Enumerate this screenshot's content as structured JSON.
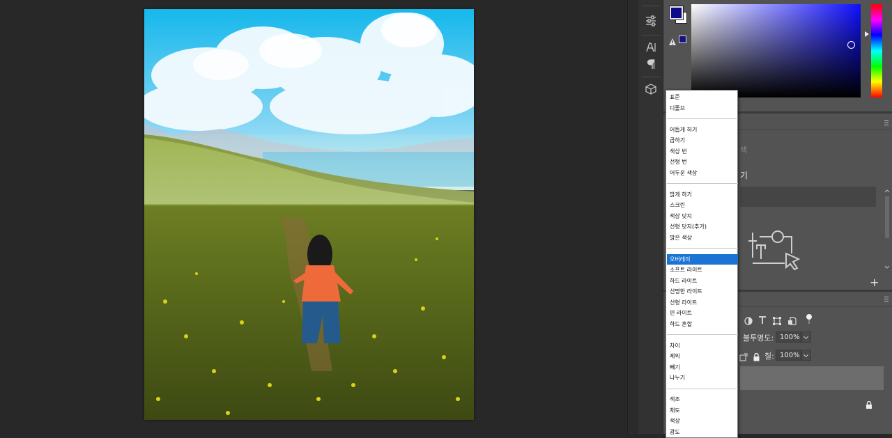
{
  "blend_menu": {
    "groups": [
      [
        "표준",
        "디졸브"
      ],
      [
        "어둡게 하기",
        "곱하기",
        "색상 번",
        "선형 번",
        "어두운 색상"
      ],
      [
        "밝게 하기",
        "스크린",
        "색상 닷지",
        "선형 닷지(추가)",
        "밝은 색상"
      ],
      [
        "오버레이",
        "소프트 라이트",
        "하드 라이트",
        "선명한 라이트",
        "선형 라이트",
        "핀 라이트",
        "하드 혼합"
      ],
      [
        "차이",
        "제외",
        "빼기",
        "나누기"
      ],
      [
        "색조",
        "채도",
        "색상",
        "광도"
      ]
    ],
    "selected": "오버레이"
  },
  "color_panel": {
    "foreground": "#0d0d8c",
    "background": "#ffffff",
    "hue": "#0000ff"
  },
  "panel": {
    "libraries_tab": "색",
    "heading": "기",
    "add_label": "+"
  },
  "layers": {
    "opacity_label": "불투명도:",
    "opacity_value": "100%",
    "fill_label": "칠:",
    "fill_value": "100%"
  },
  "icons": {
    "tool_strip": [
      "adjustments-icon",
      "character-icon",
      "paragraph-icon",
      "3d-cube-icon"
    ],
    "layers_toolbar": [
      "adjustment-filter-icon",
      "type-filter-icon",
      "shape-filter-icon",
      "smart-object-filter-icon",
      "filter-toggle-icon"
    ]
  }
}
